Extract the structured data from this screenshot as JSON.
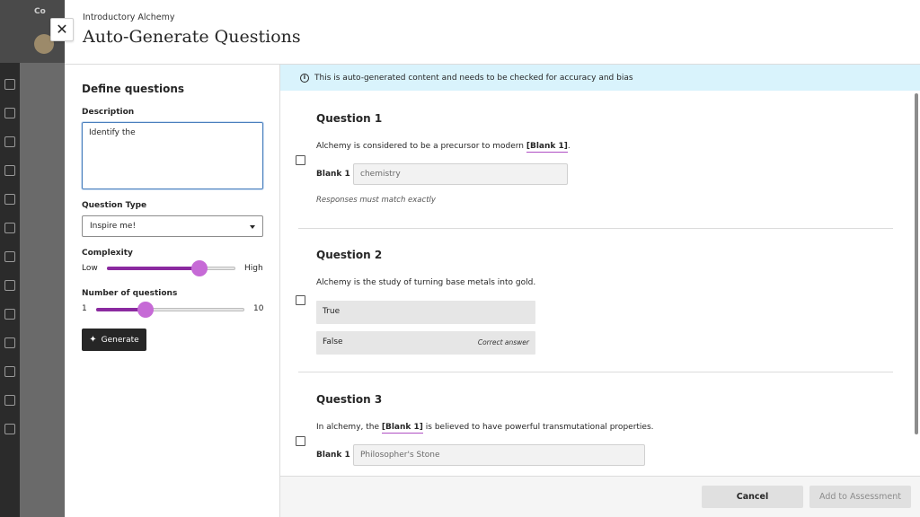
{
  "background": {
    "top_label": "Co"
  },
  "modal": {
    "close_glyph": "✕",
    "breadcrumb": "Introductory Alchemy",
    "title": "Auto-Generate Questions"
  },
  "define": {
    "title": "Define questions",
    "description_label": "Description",
    "description_value": "Identify the",
    "question_type_label": "Question Type",
    "question_type_value": "Inspire me!",
    "complexity_label": "Complexity",
    "complexity_min": "Low",
    "complexity_max": "High",
    "complexity_level": 0.72,
    "number_label": "Number of questions",
    "number_min": "1",
    "number_max": "10",
    "number_value": 4,
    "generate_label": "Generate"
  },
  "notice": {
    "icon": "info-icon",
    "text": "This is auto-generated content and needs to be checked for accuracy and bias"
  },
  "questions": [
    {
      "title": "Question 1",
      "text_before": "Alchemy is considered to be a precursor to modern ",
      "blank_ref": "[Blank 1]",
      "text_after": ".",
      "blank_label": "Blank 1",
      "blank_value": "chemistry",
      "hint": "Responses must match exactly"
    },
    {
      "title": "Question 2",
      "text": "Alchemy is the study of turning base metals into gold.",
      "options": [
        {
          "label": "True",
          "tag": ""
        },
        {
          "label": "False",
          "tag": "Correct answer"
        }
      ]
    },
    {
      "title": "Question 3",
      "text_before": "In alchemy, the ",
      "blank_ref": "[Blank 1]",
      "text_after": " is believed to have powerful transmutational properties.",
      "blank_label": "Blank 1",
      "blank_value": "Philosopher's Stone"
    }
  ],
  "footer": {
    "cancel_label": "Cancel",
    "add_label": "Add to Assessment"
  },
  "colors": {
    "accent": "#8b2aa0",
    "thumb": "#c66ad6",
    "notice_bg": "#d9f3fc"
  }
}
